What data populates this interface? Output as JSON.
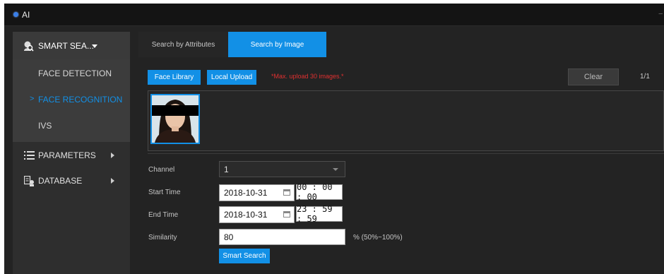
{
  "window": {
    "title": "AI"
  },
  "sidebar": {
    "header": "SMART SEA...",
    "sub_items": [
      "FACE DETECTION",
      "FACE RECOGNITION",
      "IVS"
    ],
    "active_marker": ">",
    "items": [
      "PARAMETERS",
      "DATABASE"
    ]
  },
  "tabs": [
    "Search by Attributes",
    "Search by Image"
  ],
  "toolbar": {
    "face_library": "Face Library",
    "local_upload": "Local Upload",
    "hint": "*Max. upload 30 images.*",
    "clear": "Clear",
    "pager": "1/1"
  },
  "form": {
    "channel": {
      "label": "Channel",
      "value": "1"
    },
    "start_time": {
      "label": "Start Time",
      "date": "2018-10-31",
      "time": "00 : 00 : 00"
    },
    "end_time": {
      "label": "End Time",
      "date": "2018-10-31",
      "time": "23 : 59 : 59"
    },
    "similarity": {
      "label": "Similarity",
      "value": "80",
      "suffix": "% (50%~100%)"
    },
    "submit": "Smart Search"
  },
  "colors": {
    "accent": "#1290e6",
    "warning": "#e03030",
    "background": "#232323"
  },
  "icons": [
    "ai-dot-icon",
    "face-search-icon",
    "parameters-list-icon",
    "database-icon"
  ]
}
